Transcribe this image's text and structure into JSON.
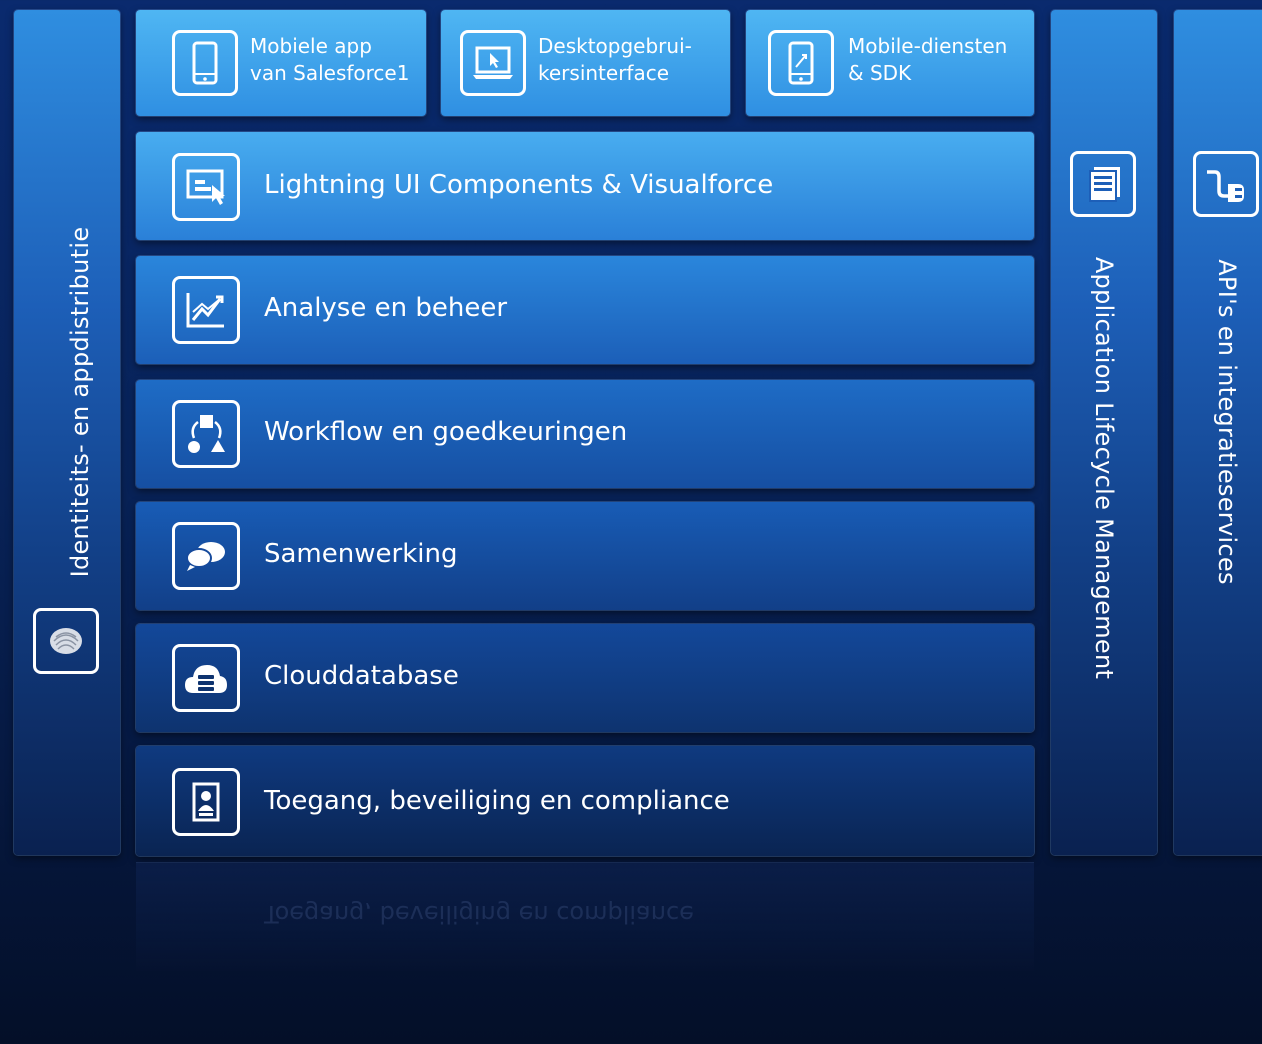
{
  "left_column": {
    "label": "Identiteits- en appdistributie",
    "icon": "fingerprint-icon"
  },
  "top_tiles": [
    {
      "line1": "Mobiele app",
      "line2": "van Salesforce1",
      "icon": "smartphone-icon"
    },
    {
      "line1": "Desktopgebrui-",
      "line2": "kersinterface",
      "icon": "desktop-icon"
    },
    {
      "line1": "Mobile-diensten",
      "line2": "& SDK",
      "icon": "mobile-sdk-icon"
    }
  ],
  "layers": [
    {
      "label": "Lightning UI Components & Visualforce",
      "icon": "ui-components-icon"
    },
    {
      "label": "Analyse en beheer",
      "icon": "analytics-chart-icon"
    },
    {
      "label": "Workflow en goedkeuringen",
      "icon": "workflow-icon"
    },
    {
      "label": "Samenwerking",
      "icon": "chat-bubbles-icon"
    },
    {
      "label": "Clouddatabase",
      "icon": "cloud-database-icon"
    },
    {
      "label": "Toegang, beveiliging en compliance",
      "icon": "id-badge-icon"
    }
  ],
  "right_columns": [
    {
      "label": "Application Lifecycle Management",
      "icon": "documents-icon"
    },
    {
      "label": "API's en integratieservices",
      "icon": "plug-icon"
    }
  ],
  "reflection_text": "Toegang, beveiliging en compliance",
  "colors": {
    "background_top": "#0a2a6e",
    "background_bottom": "#040f28",
    "tile_light": "#3fa6ec",
    "tile_dark": "#0c2f6b",
    "text": "#ffffff"
  }
}
